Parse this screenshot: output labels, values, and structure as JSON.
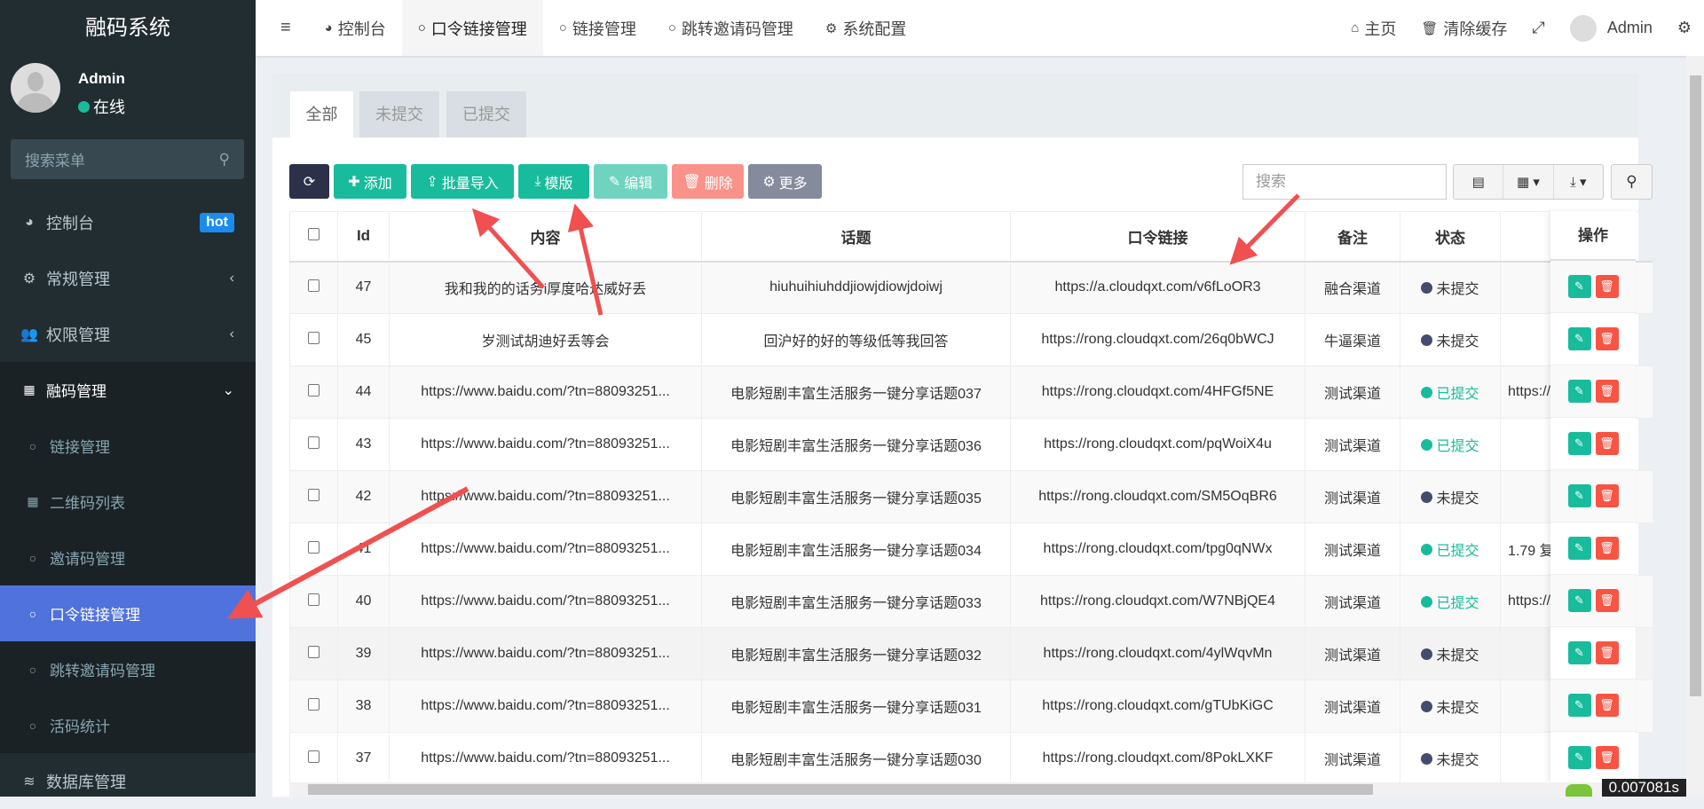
{
  "app_title": "融码系统",
  "user": {
    "name": "Admin",
    "status": "在线"
  },
  "sidebar": {
    "search_placeholder": "搜索菜单",
    "items": [
      {
        "label": "控制台",
        "badge": "hot"
      },
      {
        "label": "常规管理"
      },
      {
        "label": "权限管理"
      },
      {
        "label": "融码管理"
      },
      {
        "label": "链接管理"
      },
      {
        "label": "二维码列表"
      },
      {
        "label": "邀请码管理"
      },
      {
        "label": "口令链接管理"
      },
      {
        "label": "跳转邀请码管理"
      },
      {
        "label": "活码统计"
      },
      {
        "label": "数据库管理"
      }
    ]
  },
  "topnav": {
    "tabs": [
      "控制台",
      "口令链接管理",
      "链接管理",
      "跳转邀请码管理",
      "系统配置"
    ],
    "home": "主页",
    "clear_cache": "清除缓存",
    "admin": "Admin"
  },
  "panel": {
    "tabs": [
      "全部",
      "未提交",
      "已提交"
    ],
    "toolbar": {
      "add": "添加",
      "import": "批量导入",
      "template": "模版",
      "edit": "编辑",
      "delete": "删除",
      "more": "更多"
    },
    "search_placeholder": "搜索"
  },
  "table": {
    "headers": [
      "Id",
      "内容",
      "话题",
      "口令链接",
      "备注",
      "状态",
      "",
      "操作"
    ],
    "rows": [
      {
        "id": "47",
        "content": "我和我的的话务i厚度哈达威好丢",
        "topic": "hiuhuihiuhddjiowjdiowjdoiwj",
        "link": "https://a.cloudqxt.com/v6fLoOR3",
        "note": "融合渠道",
        "status": "未提交",
        "extra": ""
      },
      {
        "id": "45",
        "content": "岁测试胡迪好丢等会",
        "topic": "回沪好的好的等级低等我回答",
        "link": "https://rong.cloudqxt.com/26q0bWCJ",
        "note": "牛逼渠道",
        "status": "未提交",
        "extra": ""
      },
      {
        "id": "44",
        "content": "https://www.baidu.com/?tn=88093251...",
        "topic": "电影短剧丰富生活服务一键分享话题037",
        "link": "https://rong.cloudqxt.com/4HFGf5NE",
        "note": "测试渠道",
        "status": "已提交",
        "extra": "https://\\"
      },
      {
        "id": "43",
        "content": "https://www.baidu.com/?tn=88093251...",
        "topic": "电影短剧丰富生活服务一键分享话题036",
        "link": "https://rong.cloudqxt.com/pqWoiX4u",
        "note": "测试渠道",
        "status": "已提交",
        "extra": ""
      },
      {
        "id": "42",
        "content": "https://www.baidu.com/?tn=88093251...",
        "topic": "电影短剧丰富生活服务一键分享话题035",
        "link": "https://rong.cloudqxt.com/SM5OqBR6",
        "note": "测试渠道",
        "status": "未提交",
        "extra": ""
      },
      {
        "id": "41",
        "content": "https://www.baidu.com/?tn=88093251...",
        "topic": "电影短剧丰富生活服务一键分享话题034",
        "link": "https://rong.cloudqxt.com/tpg0qNWx",
        "note": "测试渠道",
        "status": "已提交",
        "extra": "1.79 复"
      },
      {
        "id": "40",
        "content": "https://www.baidu.com/?tn=88093251...",
        "topic": "电影短剧丰富生活服务一键分享话题033",
        "link": "https://rong.cloudqxt.com/W7NBjQE4",
        "note": "测试渠道",
        "status": "已提交",
        "extra": "https://"
      },
      {
        "id": "39",
        "content": "https://www.baidu.com/?tn=88093251...",
        "topic": "电影短剧丰富生活服务一键分享话题032",
        "link": "https://rong.cloudqxt.com/4ylWqvMn",
        "note": "测试渠道",
        "status": "未提交",
        "extra": ""
      },
      {
        "id": "38",
        "content": "https://www.baidu.com/?tn=88093251...",
        "topic": "电影短剧丰富生活服务一键分享话题031",
        "link": "https://rong.cloudqxt.com/gTUbKiGC",
        "note": "测试渠道",
        "status": "未提交",
        "extra": ""
      },
      {
        "id": "37",
        "content": "https://www.baidu.com/?tn=88093251...",
        "topic": "电影短剧丰富生活服务一键分享话题030",
        "link": "https://rong.cloudqxt.com/8PokLXKF",
        "note": "测试渠道",
        "status": "未提交",
        "extra": ""
      }
    ]
  },
  "timer": "0.007081s",
  "colors": {
    "primary": "#18bc9c",
    "danger": "#f75444",
    "active": "#5072dc",
    "pending": "#444c6e",
    "dark": "#2c3049"
  }
}
